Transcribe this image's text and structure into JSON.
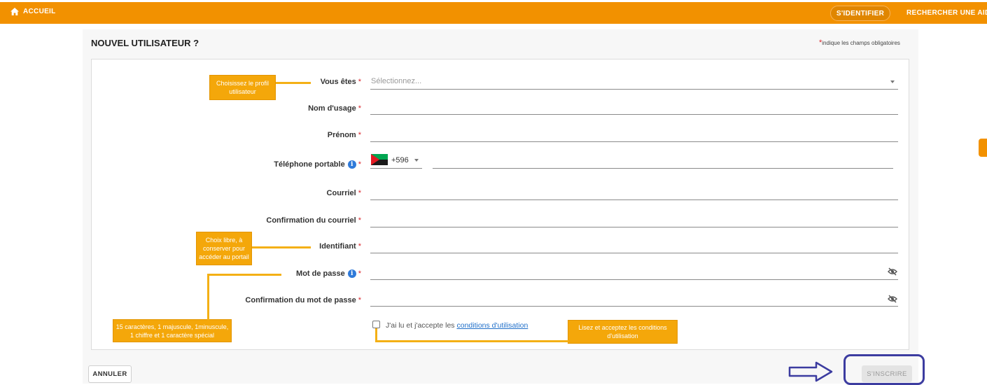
{
  "topbar": {
    "home_label": "ACCUEIL",
    "login_label": "S'IDENTIFIER",
    "search_label": "RECHERCHER UNE AIDE"
  },
  "form": {
    "title": "NOUVEL UTILISATEUR ?",
    "required_star": "*",
    "required_note": "indique les champs obligatoires",
    "fields": {
      "profile": {
        "label": "Vous êtes",
        "placeholder": "Sélectionnez..."
      },
      "lastname": {
        "label": "Nom d'usage"
      },
      "firstname": {
        "label": "Prénom"
      },
      "phone": {
        "label": "Téléphone portable",
        "dial_code": "+596",
        "info": "i"
      },
      "email": {
        "label": "Courriel"
      },
      "email_confirm": {
        "label": "Confirmation du courriel"
      },
      "username": {
        "label": "Identifiant"
      },
      "password": {
        "label": "Mot de passe",
        "info": "i"
      },
      "password_confirm": {
        "label": "Confirmation du mot de passe"
      }
    },
    "terms": {
      "prefix": "J'ai lu et j'accepte les ",
      "link": "conditions d'utilisation"
    },
    "cancel_label": "ANNULER",
    "submit_label": "S'INSCRIRE"
  },
  "callouts": {
    "profile": "Choisissez le profil utilisateur",
    "username": "Choix libre, à conserver pour accéder au portail",
    "password": "15 caractères, 1 majuscule, 1minuscule, 1 chiffre et 1 caractère spécial",
    "terms": "Lisez et acceptez les conditions d'utilisation"
  },
  "colors": {
    "topbar": "#f29100",
    "callout": "#f4a70a",
    "required": "#d9262c",
    "link": "#1f6fc9",
    "annotation_arrow": "#3c3ca0"
  },
  "icons": {
    "home": "home-icon",
    "info": "info-icon",
    "eye_off": "eye-off-icon",
    "dropdown": "chevron-down-icon",
    "flag": "martinique-flag-icon",
    "arrow": "right-arrow-icon"
  }
}
